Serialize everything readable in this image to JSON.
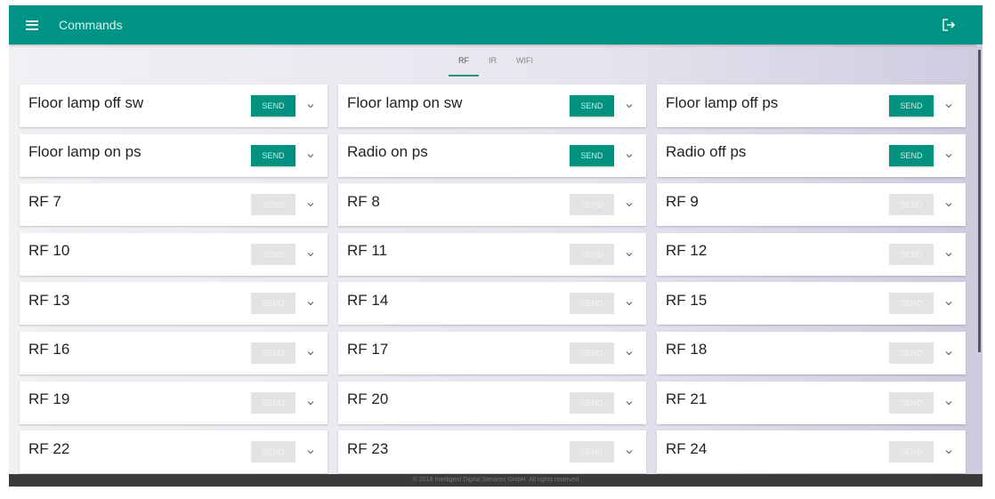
{
  "header": {
    "title": "Commands",
    "menu_icon": "hamburger-icon",
    "logout_icon": "logout-icon"
  },
  "tabs": [
    {
      "label": "RF",
      "active": true
    },
    {
      "label": "IR",
      "active": false
    },
    {
      "label": "WIFI",
      "active": false
    }
  ],
  "send_label": "SEND",
  "commands": [
    {
      "name": "Floor lamp off sw",
      "enabled": true
    },
    {
      "name": "Floor lamp on sw",
      "enabled": true
    },
    {
      "name": "Floor lamp off ps",
      "enabled": true
    },
    {
      "name": "Floor lamp on ps",
      "enabled": true
    },
    {
      "name": "Radio on ps",
      "enabled": true
    },
    {
      "name": "Radio off ps",
      "enabled": true
    },
    {
      "name": "RF 7",
      "enabled": false
    },
    {
      "name": "RF 8",
      "enabled": false
    },
    {
      "name": "RF 9",
      "enabled": false
    },
    {
      "name": "RF 10",
      "enabled": false
    },
    {
      "name": "RF 11",
      "enabled": false
    },
    {
      "name": "RF 12",
      "enabled": false
    },
    {
      "name": "RF 13",
      "enabled": false
    },
    {
      "name": "RF 14",
      "enabled": false
    },
    {
      "name": "RF 15",
      "enabled": false
    },
    {
      "name": "RF 16",
      "enabled": false
    },
    {
      "name": "RF 17",
      "enabled": false
    },
    {
      "name": "RF 18",
      "enabled": false
    },
    {
      "name": "RF 19",
      "enabled": false
    },
    {
      "name": "RF 20",
      "enabled": false
    },
    {
      "name": "RF 21",
      "enabled": false
    },
    {
      "name": "RF 22",
      "enabled": false
    },
    {
      "name": "RF 23",
      "enabled": false
    },
    {
      "name": "RF 24",
      "enabled": false
    }
  ],
  "footer": {
    "text": "© 2018 Intelligent Digital Services GmbH. All rights reserved"
  },
  "colors": {
    "primary": "#009485",
    "footer": "#3a3a3a"
  }
}
